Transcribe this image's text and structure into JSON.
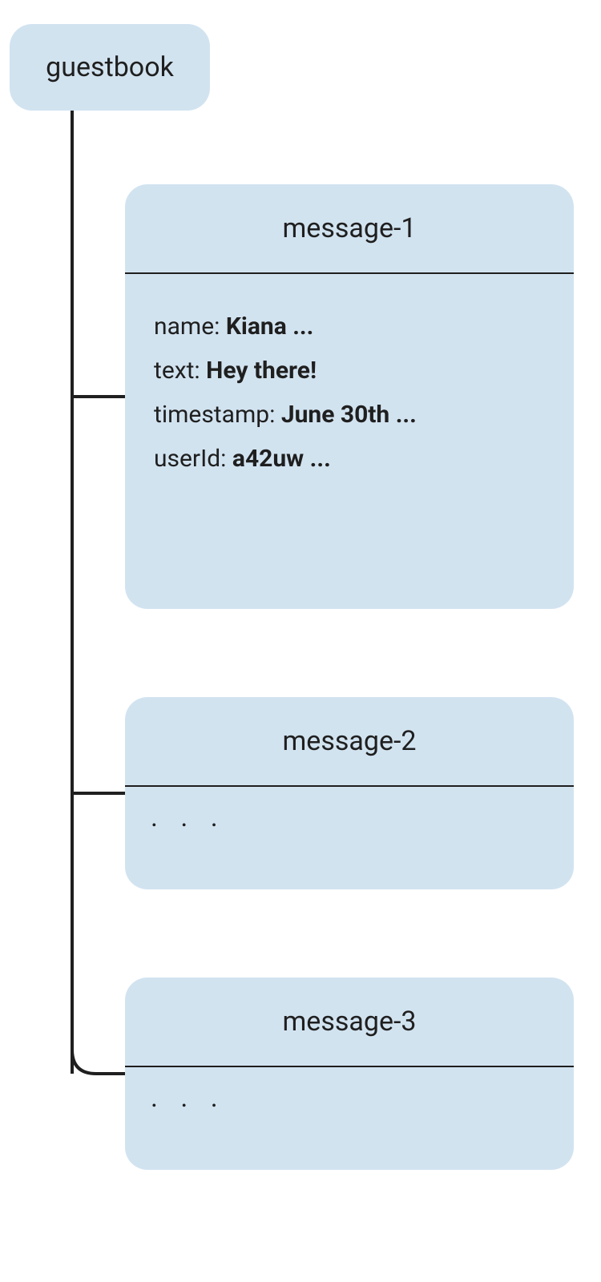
{
  "root": {
    "label": "guestbook"
  },
  "messages": [
    {
      "title": "message-1",
      "fields": [
        {
          "key": "name:",
          "value": "Kiana ..."
        },
        {
          "key": "text:",
          "value": "Hey there!"
        },
        {
          "key": "timestamp:",
          "value": "June 30th ..."
        },
        {
          "key": "userId:",
          "value": "a42uw ..."
        }
      ]
    },
    {
      "title": "message-2",
      "ellipsis": ". . ."
    },
    {
      "title": "message-3",
      "ellipsis": ". . ."
    }
  ]
}
